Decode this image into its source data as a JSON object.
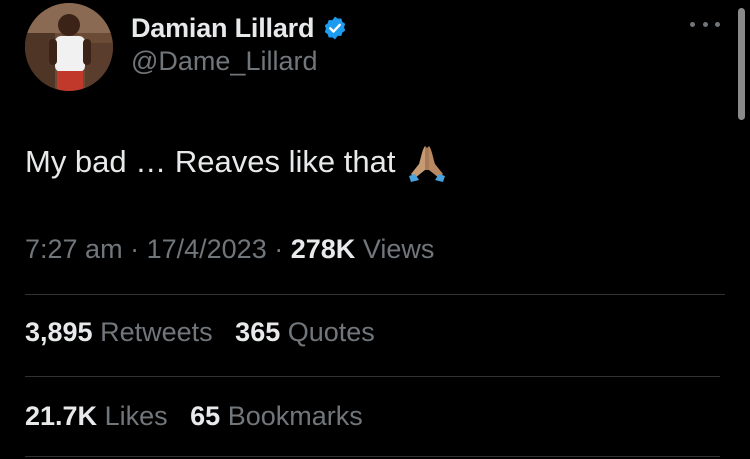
{
  "author": {
    "display_name": "Damian Lillard",
    "handle": "@Dame_Lillard",
    "verified": true
  },
  "tweet": {
    "text": "My bad … Reaves like that",
    "emoji": "folded-hands-icon"
  },
  "meta": {
    "time": "7:27 am",
    "sep1": "·",
    "date": "17/4/2023",
    "sep2": "·",
    "views_count": "278K",
    "views_label": "Views"
  },
  "stats": {
    "retweets_count": "3,895",
    "retweets_label": "Retweets",
    "quotes_count": "365",
    "quotes_label": "Quotes",
    "likes_count": "21.7K",
    "likes_label": "Likes",
    "bookmarks_count": "65",
    "bookmarks_label": "Bookmarks"
  },
  "colors": {
    "background": "#000000",
    "primary_text": "#e7e9ea",
    "secondary_text": "#71767b",
    "verified_blue": "#1d9bf0",
    "divider": "#2f3336"
  }
}
